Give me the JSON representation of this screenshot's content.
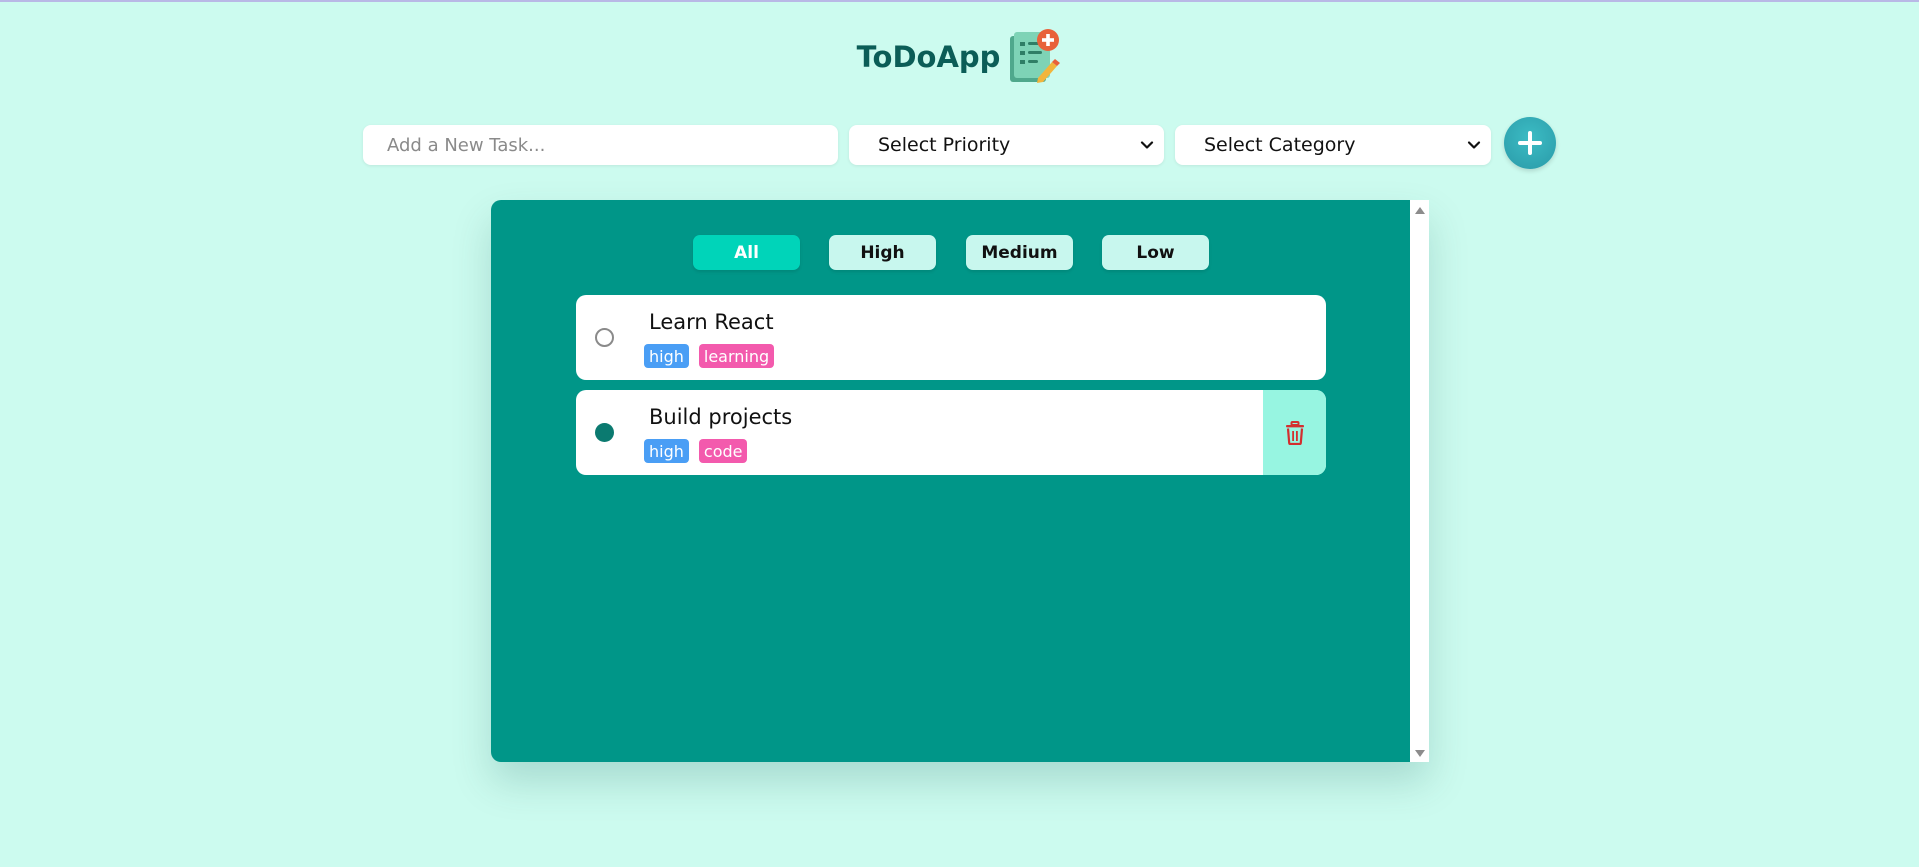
{
  "app": {
    "title": "ToDoApp",
    "logo_icon": "todo-list-logo-icon"
  },
  "controls": {
    "task_placeholder": "Add a New Task...",
    "task_value": "",
    "priority_select": {
      "selected": "Select Priority"
    },
    "category_select": {
      "selected": "Select Category"
    },
    "add_button_icon": "plus-icon"
  },
  "filters": [
    {
      "label": "All",
      "active": true
    },
    {
      "label": "High",
      "active": false
    },
    {
      "label": "Medium",
      "active": false
    },
    {
      "label": "Low",
      "active": false
    }
  ],
  "tasks": [
    {
      "title": "Learn React",
      "priority": "high",
      "category": "learning",
      "completed": false
    },
    {
      "title": "Build projects",
      "priority": "high",
      "category": "code",
      "completed": true,
      "delete_icon": "trash-icon"
    }
  ],
  "colors": {
    "background": "#ccfbef",
    "panel": "#009688",
    "accent": "#00d4b9",
    "priority_tag": "#4a9ef5",
    "category_tag": "#f35aad",
    "delete_bg": "#97f5e1",
    "delete_icon": "#d32f2f",
    "title": "#0b5d57"
  }
}
